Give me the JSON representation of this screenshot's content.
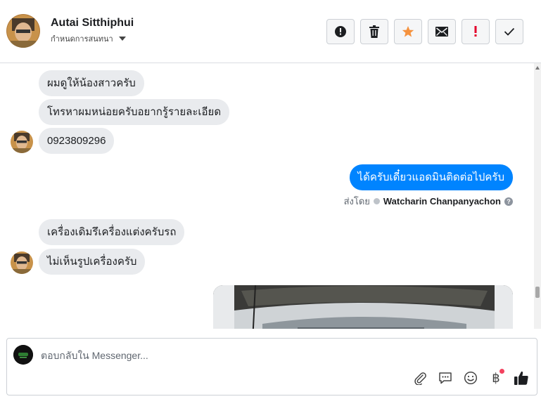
{
  "header": {
    "contact_name": "Autai Sitthiphui",
    "assign_label": "กำหนดการสนทนา",
    "actions": [
      {
        "icon": "alert-circle-icon",
        "name": "mark-spam-button"
      },
      {
        "icon": "trash-icon",
        "name": "delete-button"
      },
      {
        "icon": "star-icon",
        "name": "star-button"
      },
      {
        "icon": "envelope-icon",
        "name": "mark-unread-button"
      },
      {
        "icon": "exclamation-icon",
        "name": "flag-button"
      },
      {
        "icon": "check-icon",
        "name": "done-button"
      }
    ]
  },
  "messages": {
    "m1": "ผมดูให้น้องสาวครับ",
    "m2": "โทรหาผมหน่อยครับอยากรู้รายละเอียด",
    "m3": "0923809296",
    "out1": "ได้ครับเดี๋ยวแอดมินติดต่อไปครับ",
    "sent_by_label": "ส่งโดย",
    "sent_by_agent": "Watcharin Chanpanyachon",
    "m4": "เครื่องเดิมรึเครื่องแต่งครับรถ",
    "m5": "ไม่เห็นรูปเครื่องครับ"
  },
  "composer": {
    "placeholder": "ตอบกลับใน Messenger...",
    "tools": [
      "paperclip-icon",
      "saved-reply-icon",
      "emoji-icon",
      "baht-icon",
      "thumbs-up-icon"
    ],
    "baht_symbol": "฿"
  },
  "colors": {
    "accent": "#0084ff",
    "incoming_bubble": "#e9ebee",
    "star": "#f5923e",
    "flag": "#e4002b"
  }
}
